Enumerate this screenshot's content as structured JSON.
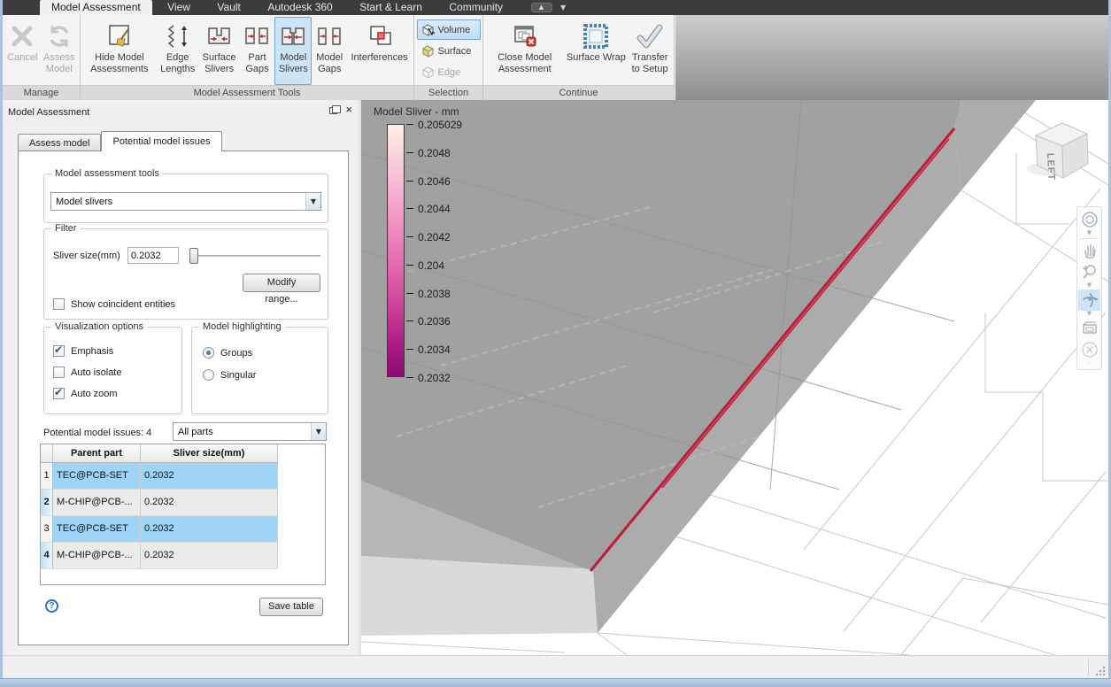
{
  "menu": {
    "tabs": [
      {
        "label": "Model Assessment",
        "active": true
      },
      {
        "label": "View",
        "active": false
      },
      {
        "label": "Vault",
        "active": false
      },
      {
        "label": "Autodesk 360",
        "active": false
      },
      {
        "label": "Start & Learn",
        "active": false
      },
      {
        "label": "Community",
        "active": false
      }
    ]
  },
  "ribbon": {
    "groups": [
      {
        "title": "Manage",
        "buttons": [
          {
            "label": "Cancel",
            "disabled": true
          },
          {
            "label": "Assess Model",
            "disabled": true
          }
        ]
      },
      {
        "title": "Model Assessment Tools",
        "buttons": [
          {
            "label": "Hide Model Assessments"
          },
          {
            "label": "Edge Lengths"
          },
          {
            "label": "Surface Slivers"
          },
          {
            "label": "Part Gaps"
          },
          {
            "label": "Model Slivers",
            "selected": true
          },
          {
            "label": "Model Gaps"
          },
          {
            "label": "Interferences"
          }
        ]
      },
      {
        "title": "Selection",
        "buttons": [
          {
            "label": "Volume",
            "selected": true
          },
          {
            "label": "Surface"
          },
          {
            "label": "Edge",
            "disabled": true
          }
        ]
      },
      {
        "title": "Continue",
        "buttons": [
          {
            "label": "Close Model Assessment"
          },
          {
            "label": "Surface Wrap"
          },
          {
            "label": "Transfer to Setup"
          }
        ]
      }
    ]
  },
  "panel": {
    "title": "Model Assessment",
    "tabs": [
      {
        "label": "Assess model",
        "active": false
      },
      {
        "label": "Potential model issues",
        "active": true
      }
    ],
    "tools_group": {
      "label": "Model assessment tools",
      "combo_value": "Model slivers"
    },
    "filter": {
      "label": "Filter",
      "sliver_label": "Sliver size(mm)",
      "sliver_value": "0.2032",
      "modify_button": "Modify range...",
      "coincident_label": "Show coincident entities",
      "coincident_checked": false
    },
    "visualization": {
      "label": "Visualization options",
      "options": [
        {
          "label": "Emphasis",
          "checked": true
        },
        {
          "label": "Auto isolate",
          "checked": false
        },
        {
          "label": "Auto zoom",
          "checked": true
        }
      ]
    },
    "highlighting": {
      "label": "Model highlighting",
      "options": [
        {
          "label": "Groups",
          "selected": true
        },
        {
          "label": "Singular",
          "selected": false
        }
      ]
    },
    "issues_label": "Potential model issues: 4",
    "parts_combo_value": "All parts",
    "table": {
      "headers": [
        "Parent part",
        "Sliver size(mm)"
      ],
      "rows": [
        {
          "num": "1",
          "part": "TEC@PCB-SET",
          "size": "0.2032",
          "selected": true
        },
        {
          "num": "2",
          "part": "M-CHIP@PCB-...",
          "size": "0.2032",
          "selected": false
        },
        {
          "num": "3",
          "part": "TEC@PCB-SET",
          "size": "0.2032",
          "selected": true
        },
        {
          "num": "4",
          "part": "M-CHIP@PCB-...",
          "size": "0.2032",
          "selected": false
        }
      ]
    },
    "save_button": "Save table"
  },
  "viewport": {
    "legend": {
      "title": "Model Sliver - mm",
      "ticks": [
        "0.205029",
        "0.2048",
        "0.2046",
        "0.2044",
        "0.2042",
        "0.204",
        "0.2038",
        "0.2036",
        "0.2034",
        "0.2032"
      ],
      "gradient_top_color": "#fdf0e3",
      "gradient_bottom_color": "#8c0a72"
    },
    "viewcube": {
      "face_label": "LEFT"
    },
    "sliver_color": "#c01f3c"
  },
  "colors": {
    "menubar_bg": "#3c3c3c",
    "ribbon_selected": "#cde4f7",
    "table_selected_row": "#9ed4f6",
    "window_border": "#a9c3da"
  }
}
